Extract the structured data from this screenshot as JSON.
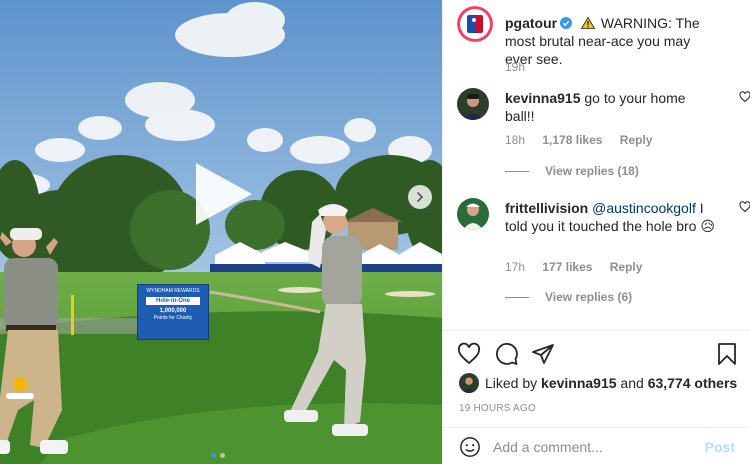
{
  "post": {
    "author": "pgatour",
    "caption_icon": "warning-icon",
    "caption": "WARNING: The most brutal near-ace you may ever see.",
    "time": "19h"
  },
  "media": {
    "sign_brand": "WYNDHAM REWARDS",
    "sign_title": "Hole-in-One",
    "sign_amount": "1,000,000",
    "sign_caption": "Points for Charity",
    "slide_dots": 2,
    "active_dot": 0
  },
  "comments": [
    {
      "user": "kevinna915",
      "text": "go to your home ball!!",
      "time": "18h",
      "likes": "1,178 likes",
      "reply": "Reply",
      "view_replies": "View replies (18)"
    },
    {
      "user": "frittellivision",
      "mention": "@austincookgolf",
      "text": " I told you it touched the hole bro 😥",
      "time": "17h",
      "likes": "177 likes",
      "reply": "Reply",
      "view_replies": "View replies (6)"
    }
  ],
  "liked_by": {
    "prefix": "Liked by ",
    "user": "kevinna915",
    "middle": " and ",
    "others": "63,774 others"
  },
  "timestamp": "19 HOURS AGO",
  "comment_box": {
    "placeholder": "Add a comment...",
    "post_label": "Post"
  },
  "colors": {
    "link": "#00376b",
    "verified": "#3897f0",
    "muted": "#8e8e8e",
    "post_disabled": "#b2dffc"
  }
}
